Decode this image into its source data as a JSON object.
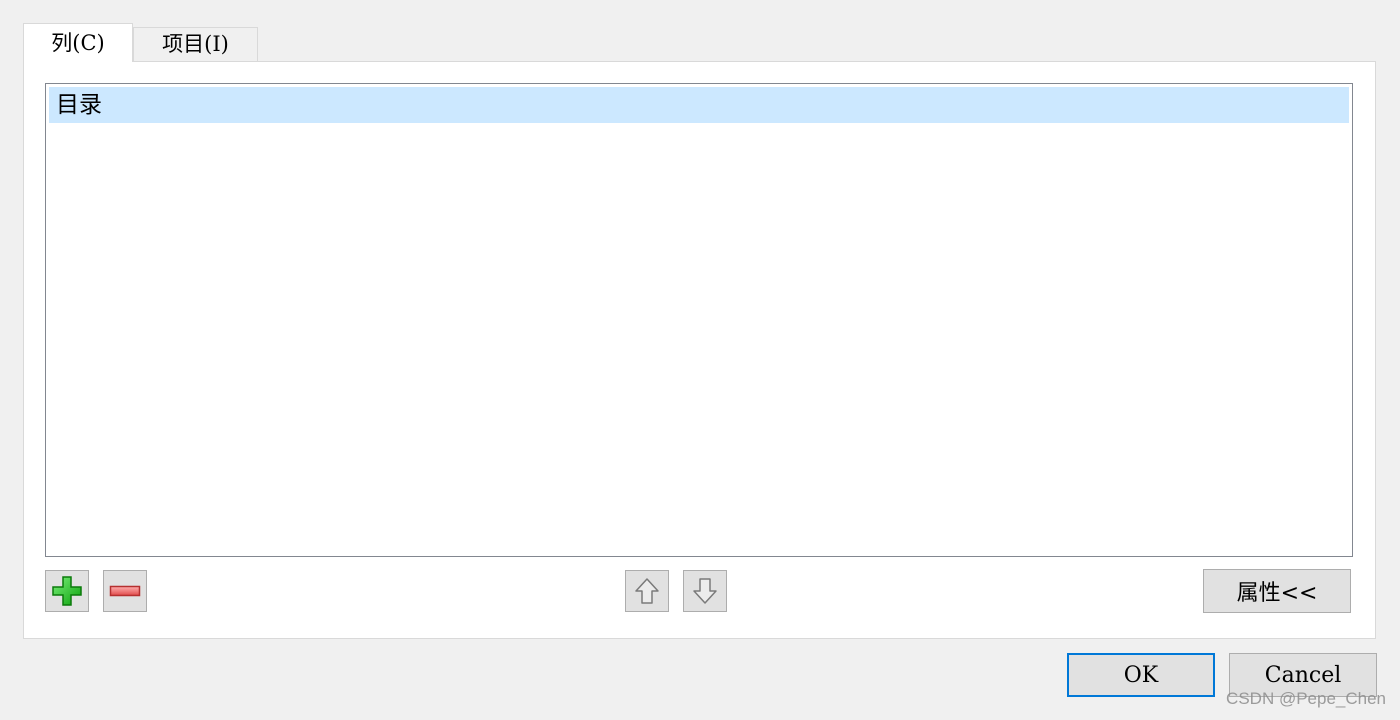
{
  "tabs": [
    {
      "label": "列(C)",
      "selected": true
    },
    {
      "label": "项目(I)",
      "selected": false
    }
  ],
  "list": {
    "items": [
      {
        "label": "目录",
        "selected": true
      }
    ]
  },
  "toolbar": {
    "add_icon": "add-icon",
    "remove_icon": "remove-icon",
    "move_up_icon": "arrow-up-icon",
    "move_down_icon": "arrow-down-icon",
    "properties_label": "属性<<"
  },
  "dialog": {
    "ok_label": "OK",
    "cancel_label": "Cancel"
  },
  "watermark": "CSDN @Pepe_Chen",
  "colors": {
    "selection": "#cce8ff",
    "focus_border": "#0078d7",
    "add_green": "#22c322",
    "remove_red": "#e05555"
  }
}
